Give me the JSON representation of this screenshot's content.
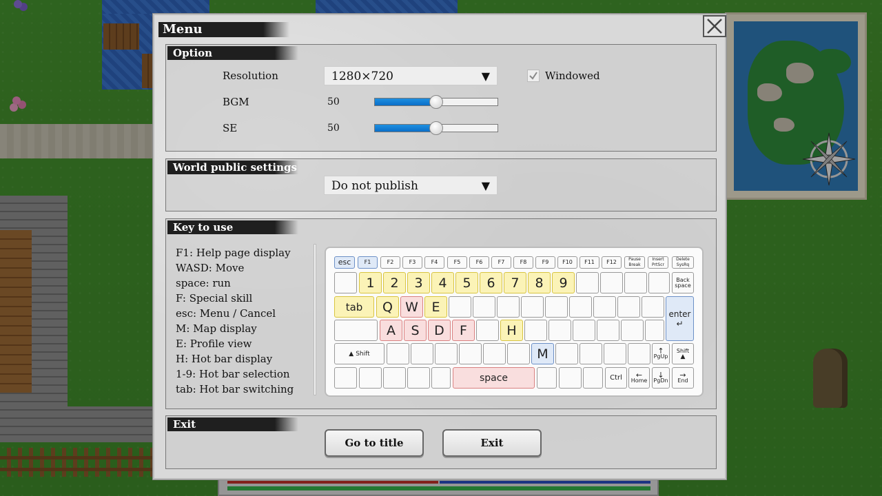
{
  "menu": {
    "title": "Menu"
  },
  "option": {
    "title": "Option",
    "resolution_label": "Resolution",
    "resolution_value": "1280×720",
    "windowed_label": "Windowed",
    "windowed_checked": true,
    "bgm_label": "BGM",
    "bgm_value": "50",
    "bgm_level": 0.5,
    "se_label": "SE",
    "se_value": "50",
    "se_level": 0.5
  },
  "world": {
    "title": "World public settings",
    "publish_value": "Do not publish"
  },
  "keys": {
    "title": "Key to use",
    "items": [
      "F1: Help page display",
      "WASD: Move",
      "space: run",
      "F: Special skill",
      "esc: Menu / Cancel",
      "M: Map display",
      "E: Profile view",
      "H: Hot bar display",
      "1-9: Hot bar selection",
      "tab: Hot bar switching"
    ],
    "keyboard": {
      "esc": "esc",
      "f_keys": [
        "F1",
        "F2",
        "F3",
        "F4",
        "F5",
        "F6",
        "F7",
        "F8",
        "F9",
        "F10",
        "F11",
        "F12"
      ],
      "pause": "Pause\nBreak",
      "insert": "Insert\nPrtScr",
      "delete": "Delete\nSysRq",
      "digits": [
        "1",
        "2",
        "3",
        "4",
        "5",
        "6",
        "7",
        "8",
        "9"
      ],
      "backspace": "Back\nspace",
      "tab": "tab",
      "q": "Q",
      "w": "W",
      "e": "E",
      "enter": "enter",
      "a": "A",
      "s": "S",
      "d": "D",
      "f": "F",
      "h": "H",
      "shift": "Shift",
      "m": "M",
      "pgup": "PgUp",
      "rshift": "Shift",
      "space": "space",
      "ctrl": "Ctrl",
      "home": "Home",
      "pgdn": "PgDn",
      "end": "End"
    }
  },
  "exit": {
    "title": "Exit",
    "go_to_title": "Go to title",
    "exit_button": "Exit"
  }
}
